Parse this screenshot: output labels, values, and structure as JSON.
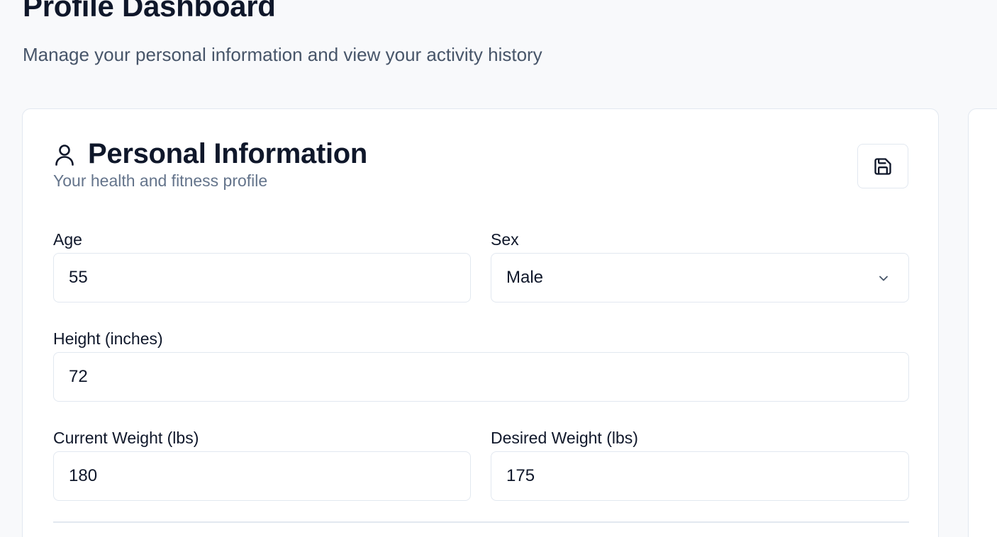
{
  "header": {
    "title": "Profile Dashboard",
    "subtitle": "Manage your personal information and view your activity history"
  },
  "personal_card": {
    "title": "Personal Information",
    "description": "Your health and fitness profile",
    "header_icon": "user-icon",
    "save_icon": "save-icon",
    "fields": {
      "age": {
        "label": "Age",
        "value": "55"
      },
      "sex": {
        "label": "Sex",
        "value": "Male",
        "icon": "chevron-down-icon"
      },
      "height": {
        "label": "Height (inches)",
        "value": "72"
      },
      "current_weight": {
        "label": "Current Weight (lbs)",
        "value": "180"
      },
      "desired_weight": {
        "label": "Desired Weight (lbs)",
        "value": "175"
      }
    }
  },
  "colors": {
    "background": "#f8f9fb",
    "card": "#ffffff",
    "border": "#e2e8f0",
    "text": "#0f172a",
    "muted": "#64748b"
  }
}
